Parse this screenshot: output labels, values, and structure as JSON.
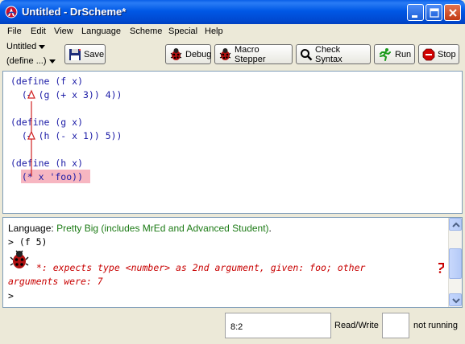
{
  "window": {
    "title": "Untitled - DrScheme*"
  },
  "menu": [
    "File",
    "Edit",
    "View",
    "Language",
    "Scheme",
    "Special",
    "Help"
  ],
  "toolbar": {
    "file_dropdown": "Untitled",
    "define_dropdown": "(define ...)",
    "save": "Save",
    "debug": "Debug",
    "macro_stepper": "Macro Stepper",
    "check_syntax": "Check Syntax",
    "run": "Run",
    "stop": "Stop"
  },
  "definitions": [
    "(define (f x)",
    "  (+ (g (+ x 3)) 4))",
    "(define (g x)",
    "  (+ (h (- x 1)) 5))",
    "(define (h x)",
    "  (* x 'foo))"
  ],
  "interactions": {
    "language_prefix": "Language: ",
    "language_name": "Pretty Big (includes MrEd and Advanced Student)",
    "language_suffix": ".",
    "prompt1": "> (f 5)",
    "error_line1": " *: expects type <number> as 2nd argument, given: foo; other",
    "error_line2": "arguments were: 7",
    "prompt2": ">"
  },
  "status": {
    "position": "8:2",
    "mode": "Read/Write",
    "running": "not running"
  },
  "colors": {
    "titlebar": "#0058e6",
    "error": "#c80000",
    "language": "#1b7a14",
    "highlight": "#f7b6c1",
    "arrow": "#d02020"
  }
}
